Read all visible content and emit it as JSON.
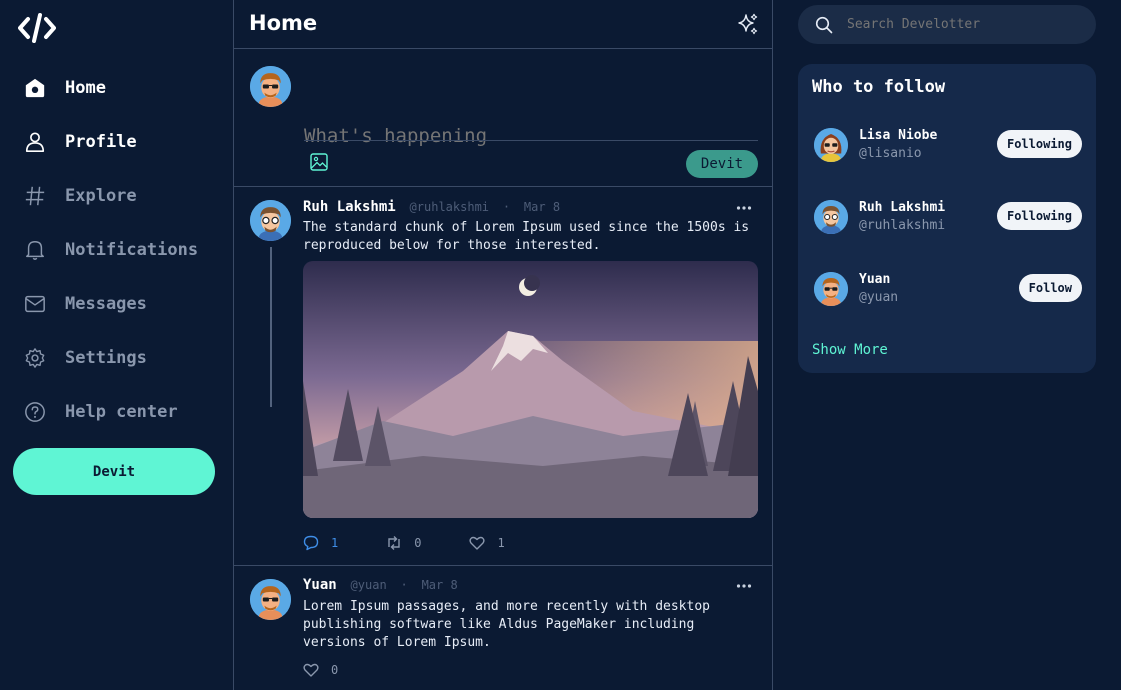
{
  "nav": {
    "items": [
      {
        "label": "Home",
        "icon": "home-icon",
        "active": true
      },
      {
        "label": "Profile",
        "icon": "user-icon",
        "active": true
      },
      {
        "label": "Explore",
        "icon": "hashtag-icon",
        "active": false
      },
      {
        "label": "Notifications",
        "icon": "bell-icon",
        "active": false
      },
      {
        "label": "Messages",
        "icon": "mail-icon",
        "active": false
      },
      {
        "label": "Settings",
        "icon": "gear-icon",
        "active": false
      },
      {
        "label": "Help center",
        "icon": "help-icon",
        "active": false
      }
    ],
    "devit_label": "Devit"
  },
  "header": {
    "title": "Home"
  },
  "composer": {
    "placeholder": "What's happening",
    "submit_label": "Devit"
  },
  "posts": [
    {
      "name": "Ruh Lakshmi",
      "handle": "@ruhlakshmi",
      "date": "Mar 8",
      "text": "The standard chunk of Lorem Ipsum used since the 1500s is reproduced below for those interested.",
      "replies": "1",
      "retweets": "0",
      "likes": "1"
    },
    {
      "name": "Yuan",
      "handle": "@yuan",
      "date": "Mar 8",
      "text": "Lorem Ipsum passages, and more recently with desktop publishing software like Aldus PageMaker including versions of Lorem Ipsum.",
      "likes": "0"
    }
  ],
  "search": {
    "placeholder": "Search Develotter"
  },
  "who_to_follow": {
    "title": "Who to follow",
    "users": [
      {
        "name": "Lisa Niobe",
        "handle": "@lisanio",
        "button": "Following"
      },
      {
        "name": "Ruh Lakshmi",
        "handle": "@ruhlakshmi",
        "button": "Following"
      },
      {
        "name": "Yuan",
        "handle": "@yuan",
        "button": "Follow"
      }
    ],
    "show_more": "Show More"
  },
  "colors": {
    "background": "#0b1a33",
    "accent": "#5ff5d4",
    "card": "#15294a",
    "link_blue": "#3f8ee8"
  }
}
